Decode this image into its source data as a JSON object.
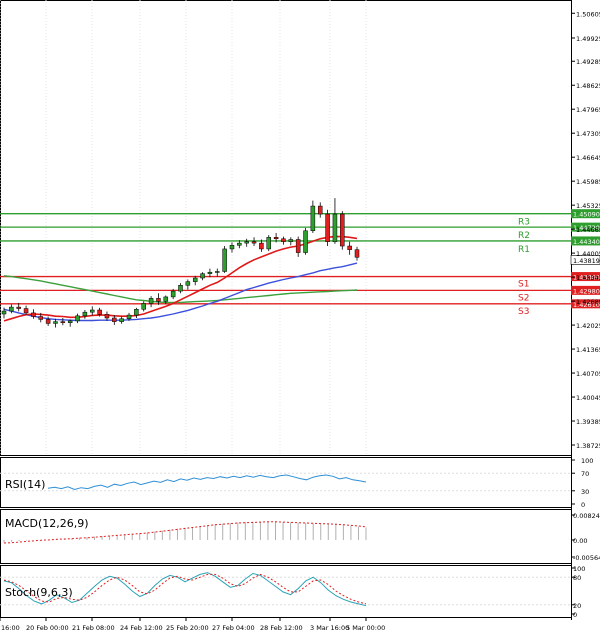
{
  "chart_data": [
    {
      "type": "candlestick",
      "panel": "main",
      "ylim": [
        1.3845,
        1.5097
      ],
      "y_ticks": [
        "1.50605",
        "1.49925",
        "1.49285",
        "1.48625",
        "1.47965",
        "1.47305",
        "1.46645",
        "1.45985",
        "1.45325",
        "1.44665",
        "1.44005",
        "1.43345",
        "1.42685",
        "1.42025",
        "1.41365",
        "1.40705",
        "1.40045",
        "1.39385",
        "1.38725"
      ],
      "x_ticks": [
        "16:00",
        "20 Feb 00:00",
        "21 Feb 08:00",
        "24 Feb 12:00",
        "25 Feb 20:00",
        "27 Feb 04:00",
        "28 Feb 12:00",
        "3 Mar 16:00",
        "5 Mar 00:00"
      ],
      "current_price": "1.43819",
      "resistance": [
        {
          "name": "R3",
          "value": "1.45090",
          "color": "#2e9e2e"
        },
        {
          "name": "R2",
          "value": "1.44720",
          "color": "#2e9e2e"
        },
        {
          "name": "R1",
          "value": "1.44340",
          "color": "#2e9e2e"
        }
      ],
      "support": [
        {
          "name": "S1",
          "value": "1.43360",
          "color": "#e02020"
        },
        {
          "name": "S2",
          "value": "1.42980",
          "color": "#e02020"
        },
        {
          "name": "S3",
          "value": "1.42610",
          "color": "#e02020"
        }
      ],
      "candles": [
        [
          1.4233,
          1.4251,
          1.4221,
          1.4241
        ],
        [
          1.4241,
          1.4259,
          1.4235,
          1.4252
        ],
        [
          1.4252,
          1.4263,
          1.424,
          1.4248
        ],
        [
          1.4248,
          1.4256,
          1.423,
          1.4236
        ],
        [
          1.4236,
          1.4246,
          1.422,
          1.4226
        ],
        [
          1.4226,
          1.4236,
          1.421,
          1.4218
        ],
        [
          1.4218,
          1.4226,
          1.42,
          1.4207
        ],
        [
          1.4207,
          1.422,
          1.4196,
          1.4212
        ],
        [
          1.4212,
          1.4222,
          1.4202,
          1.4209
        ],
        [
          1.4209,
          1.4218,
          1.4198,
          1.4214
        ],
        [
          1.4214,
          1.4234,
          1.4208,
          1.4228
        ],
        [
          1.4228,
          1.4244,
          1.422,
          1.4238
        ],
        [
          1.4238,
          1.4254,
          1.4229,
          1.4244
        ],
        [
          1.4244,
          1.425,
          1.4226,
          1.4232
        ],
        [
          1.4232,
          1.424,
          1.4214,
          1.4222
        ],
        [
          1.4222,
          1.423,
          1.4203,
          1.4212
        ],
        [
          1.4212,
          1.4226,
          1.4206,
          1.422
        ],
        [
          1.422,
          1.4236,
          1.4214,
          1.423
        ],
        [
          1.423,
          1.425,
          1.4222,
          1.4246
        ],
        [
          1.4246,
          1.4268,
          1.424,
          1.4262
        ],
        [
          1.4262,
          1.4282,
          1.4252,
          1.4276
        ],
        [
          1.4276,
          1.429,
          1.4258,
          1.4268
        ],
        [
          1.4268,
          1.4284,
          1.426,
          1.428
        ],
        [
          1.428,
          1.4302,
          1.4274,
          1.4296
        ],
        [
          1.4296,
          1.4318,
          1.429,
          1.4312
        ],
        [
          1.4312,
          1.4328,
          1.43,
          1.4322
        ],
        [
          1.4322,
          1.4338,
          1.4312,
          1.4332
        ],
        [
          1.4332,
          1.4348,
          1.4326,
          1.4344
        ],
        [
          1.4344,
          1.4358,
          1.4334,
          1.4348
        ],
        [
          1.4348,
          1.4358,
          1.4336,
          1.435
        ],
        [
          1.435,
          1.442,
          1.4346,
          1.4412
        ],
        [
          1.4412,
          1.443,
          1.4402,
          1.4422
        ],
        [
          1.4422,
          1.4436,
          1.4414,
          1.4428
        ],
        [
          1.4428,
          1.444,
          1.4418,
          1.4432
        ],
        [
          1.4432,
          1.4444,
          1.442,
          1.4428
        ],
        [
          1.4428,
          1.4438,
          1.4404,
          1.4412
        ],
        [
          1.4412,
          1.445,
          1.4406,
          1.4444
        ],
        [
          1.4444,
          1.4456,
          1.443,
          1.444
        ],
        [
          1.444,
          1.4446,
          1.4424,
          1.4432
        ],
        [
          1.4432,
          1.4444,
          1.4422,
          1.4438
        ],
        [
          1.4438,
          1.4446,
          1.439,
          1.4402
        ],
        [
          1.4402,
          1.447,
          1.4396,
          1.4462
        ],
        [
          1.4462,
          1.4545,
          1.4456,
          1.453
        ],
        [
          1.453,
          1.454,
          1.4498,
          1.4508
        ],
        [
          1.4508,
          1.452,
          1.442,
          1.4432
        ],
        [
          1.4432,
          1.4552,
          1.4426,
          1.4508
        ],
        [
          1.4508,
          1.4516,
          1.441,
          1.442
        ],
        [
          1.442,
          1.4432,
          1.4396,
          1.441
        ],
        [
          1.441,
          1.4418,
          1.438,
          1.4389
        ]
      ],
      "ma_fast": [
        1.4214,
        1.422,
        1.4226,
        1.4231,
        1.4233,
        1.4232,
        1.423,
        1.4227,
        1.4226,
        1.4224,
        1.4224,
        1.4226,
        1.4229,
        1.423,
        1.423,
        1.4228,
        1.4227,
        1.4227,
        1.4229,
        1.4233,
        1.424,
        1.4247,
        1.4254,
        1.4262,
        1.4272,
        1.4282,
        1.4292,
        1.4302,
        1.4312,
        1.432,
        1.4332,
        1.4346,
        1.436,
        1.4372,
        1.4382,
        1.439,
        1.4398,
        1.4406,
        1.4412,
        1.4417,
        1.442,
        1.4426,
        1.4433,
        1.444,
        1.4444,
        1.4446,
        1.4446,
        1.4444,
        1.4441
      ],
      "ma_mid": [
        1.4246,
        1.4241,
        1.4236,
        1.4231,
        1.4227,
        1.4223,
        1.422,
        1.4218,
        1.4217,
        1.4216,
        1.4215,
        1.4215,
        1.4215,
        1.4216,
        1.4216,
        1.4216,
        1.4216,
        1.4217,
        1.4218,
        1.422,
        1.4222,
        1.4225,
        1.4229,
        1.4233,
        1.4238,
        1.4243,
        1.4249,
        1.4255,
        1.4262,
        1.4268,
        1.4276,
        1.4284,
        1.4292,
        1.43,
        1.4306,
        1.4312,
        1.4318,
        1.4323,
        1.4328,
        1.4332,
        1.4336,
        1.4341,
        1.4346,
        1.4352,
        1.4356,
        1.436,
        1.4363,
        1.4368,
        1.4373
      ],
      "ma_slow": [
        1.4338,
        1.4336,
        1.4333,
        1.433,
        1.4327,
        1.4324,
        1.432,
        1.4316,
        1.4312,
        1.4308,
        1.4304,
        1.43,
        1.4296,
        1.4292,
        1.4288,
        1.4284,
        1.428,
        1.4276,
        1.4272,
        1.427,
        1.4268,
        1.4266,
        1.4265,
        1.4265,
        1.4265,
        1.4266,
        1.4267,
        1.4268,
        1.4269,
        1.427,
        1.4272,
        1.4274,
        1.4276,
        1.4278,
        1.428,
        1.4282,
        1.4284,
        1.4286,
        1.4288,
        1.429,
        1.4291,
        1.4292,
        1.4293,
        1.4294,
        1.4295,
        1.4296,
        1.4297,
        1.4298,
        1.4299
      ]
    },
    {
      "type": "line",
      "panel": "rsi",
      "title": "RSI(14)",
      "ylim": [
        0,
        100
      ],
      "y_ticks": [
        "100",
        "70",
        "30",
        "0"
      ],
      "values": [
        36,
        38,
        35,
        39,
        33,
        37,
        35,
        40,
        43,
        38,
        45,
        42,
        47,
        50,
        44,
        48,
        52,
        49,
        55,
        51,
        57,
        54,
        59,
        56,
        60,
        58,
        62,
        59,
        63,
        60,
        64,
        61,
        65,
        62,
        60,
        64,
        66,
        62,
        58,
        55,
        61,
        64,
        66,
        63,
        57,
        60,
        55,
        53,
        50
      ]
    },
    {
      "type": "bar",
      "panel": "macd",
      "title": "MACD(12,26,9)",
      "ylim": [
        -0.005643,
        0.008248
      ],
      "y_ticks": [
        "0.008248",
        "0.00",
        "-0.005643"
      ],
      "macd": [
        -0.0008,
        -0.0006,
        -0.0004,
        -0.0002,
        0.0,
        0.0001,
        0.0002,
        0.0003,
        0.0004,
        0.0005,
        0.0007,
        0.0009,
        0.0011,
        0.0013,
        0.0015,
        0.0017,
        0.0019,
        0.0021,
        0.0023,
        0.0025,
        0.0028,
        0.0031,
        0.0034,
        0.0037,
        0.004,
        0.0043,
        0.0046,
        0.0049,
        0.0052,
        0.0054,
        0.0056,
        0.0058,
        0.0059,
        0.006,
        0.0061,
        0.0061,
        0.006,
        0.0059,
        0.0058,
        0.0057,
        0.0056,
        0.0055,
        0.0054,
        0.0053,
        0.0051,
        0.0049,
        0.0047,
        0.0044,
        0.0041
      ],
      "signal": [
        -0.001,
        -0.0009,
        -0.0007,
        -0.0005,
        -0.0003,
        -0.0001,
        0.0,
        0.0002,
        0.0003,
        0.0004,
        0.0006,
        0.0007,
        0.0009,
        0.0011,
        0.0013,
        0.0015,
        0.0017,
        0.0019,
        0.0021,
        0.0023,
        0.0026,
        0.0029,
        0.0032,
        0.0035,
        0.0038,
        0.0041,
        0.0044,
        0.0047,
        0.005,
        0.0052,
        0.0054,
        0.0056,
        0.0057,
        0.0058,
        0.0059,
        0.006,
        0.006,
        0.0059,
        0.0058,
        0.0057,
        0.0056,
        0.0055,
        0.0054,
        0.0053,
        0.0052,
        0.005,
        0.0048,
        0.0046,
        0.0043
      ]
    },
    {
      "type": "line",
      "panel": "stoch",
      "title": "Stoch(9,6,3)",
      "ylim": [
        0,
        100
      ],
      "y_ticks": [
        "100",
        "80",
        "20",
        "0"
      ],
      "k": [
        72,
        68,
        55,
        40,
        28,
        22,
        30,
        42,
        35,
        25,
        30,
        45,
        60,
        74,
        82,
        78,
        65,
        50,
        38,
        45,
        62,
        76,
        84,
        80,
        70,
        78,
        86,
        90,
        82,
        70,
        58,
        62,
        76,
        88,
        84,
        72,
        60,
        48,
        42,
        55,
        72,
        80,
        68,
        52,
        40,
        32,
        26,
        22,
        18
      ],
      "d": [
        74,
        70,
        62,
        50,
        38,
        28,
        26,
        34,
        36,
        32,
        30,
        36,
        48,
        62,
        74,
        80,
        74,
        62,
        48,
        44,
        52,
        66,
        78,
        82,
        76,
        74,
        80,
        86,
        86,
        78,
        66,
        60,
        66,
        78,
        86,
        80,
        70,
        58,
        48,
        48,
        60,
        72,
        74,
        64,
        50,
        40,
        32,
        26,
        22
      ]
    }
  ]
}
